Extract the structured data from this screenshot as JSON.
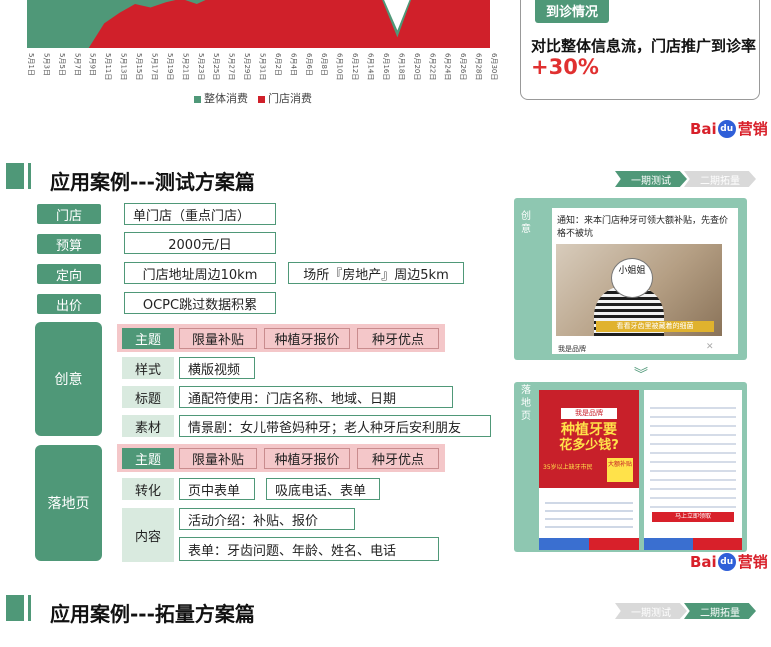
{
  "chart_data": {
    "type": "area",
    "x": [
      "5月1日",
      "5月3日",
      "5月5日",
      "5月7日",
      "5月9日",
      "5月11日",
      "5月13日",
      "5月15日",
      "5月17日",
      "5月19日",
      "5月21日",
      "5月23日",
      "5月25日",
      "5月27日",
      "5月29日",
      "5月31日",
      "6月2日",
      "6月4日",
      "6月6日",
      "6月8日",
      "6月10日",
      "6月12日",
      "6月14日",
      "6月16日",
      "6月18日",
      "6月20日",
      "6月22日",
      "6月24日",
      "6月26日",
      "6月28日",
      "6月30日"
    ],
    "series": [
      {
        "name": "整体消费",
        "color": "#4f9878",
        "values": [
          0.55,
          0.58,
          0.6,
          0.62,
          0.55,
          0.6,
          0.58,
          0.62,
          0.6,
          0.64,
          0.62,
          0.66,
          0.6,
          0.64,
          0.62,
          0.66,
          0.64,
          0.68,
          0.6,
          0.66,
          0.64,
          0.66,
          0.62,
          0.6,
          0.2,
          0.64,
          0.66,
          0.68,
          0.7,
          0.72,
          0.7
        ]
      },
      {
        "name": "门店消费",
        "color": "#d0202a",
        "values": [
          0,
          0,
          0,
          0,
          0,
          0.28,
          0.4,
          0.5,
          0.46,
          0.52,
          0.56,
          0.5,
          0.58,
          0.6,
          0.56,
          0.62,
          0.6,
          0.64,
          0.56,
          0.6,
          0.62,
          0.58,
          0.6,
          0.55,
          0.12,
          0.6,
          0.62,
          0.65,
          0.66,
          0.68,
          0.66
        ]
      }
    ],
    "ylim": [
      0,
      1
    ],
    "legend": "bottom"
  },
  "callout": {
    "badge": "到诊情况",
    "text": "对比整体信息流，门店推广到诊率",
    "percent": "+30%"
  },
  "baidu_logo": {
    "bai": "Bai",
    "du": "du",
    "ying": "营销"
  },
  "section1": {
    "title": "应用案例---测试方案篇",
    "step1": "一期测试",
    "step2": "二期拓量"
  },
  "section2": {
    "title": "应用案例---拓量方案篇",
    "step1": "一期测试",
    "step2": "二期拓量"
  },
  "table": {
    "store_label": "门店",
    "store_value": "单门店（重点门店）",
    "budget_label": "预算",
    "budget_value": "2000元/日",
    "target_label": "定向",
    "target_value1": "门店地址周边10km",
    "target_value2": "场所『房地产』周边5km",
    "bid_label": "出价",
    "bid_value": "OCPC跳过数据积累",
    "creative_label": "创意",
    "creative_rows": {
      "theme_label": "主题",
      "themes": [
        "限量补贴",
        "种植牙报价",
        "种牙优点"
      ],
      "style_label": "样式",
      "style_value": "横版视频",
      "title_label": "标题",
      "title_value": "通配符使用：门店名称、地域、日期",
      "material_label": "素材",
      "material_value": "情景剧：女儿带爸妈种牙；老人种牙后安利朋友"
    },
    "landing_label": "落地页",
    "landing_rows": {
      "theme_label": "主题",
      "themes": [
        "限量补贴",
        "种植牙报价",
        "种牙优点"
      ],
      "convert_label": "转化",
      "convert_values": [
        "页中表单",
        "吸底电话、表单"
      ],
      "content_label": "内容",
      "content_values": [
        "活动介绍：补贴、报价",
        "表单：牙齿问题、年龄、姓名、电话"
      ]
    }
  },
  "preview": {
    "creative_tag": "创意",
    "landing_tag": "落地页",
    "ad_text": "通知：来本门店种牙可领大额补贴，先查价格不被坑",
    "bubble": "小姐姐",
    "caption": "看看牙齿里被藏着的细菌",
    "brand": "我是品牌",
    "lp_brand": "我是品牌",
    "lp_headline1": "种植牙要",
    "lp_headline2": "花多少钱?",
    "lp_sub": "35岁以上缺牙市民",
    "lp_badge": "大额补贴",
    "lp_btn": "马上立即领取"
  }
}
